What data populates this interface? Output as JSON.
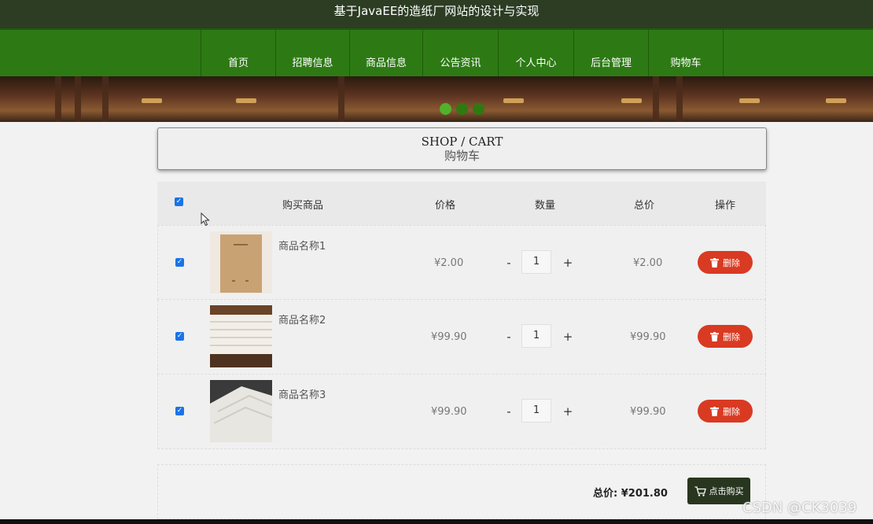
{
  "header": {
    "title": "基于JavaEE的造纸厂网站的设计与实现"
  },
  "nav": {
    "items": [
      "首页",
      "招聘信息",
      "商品信息",
      "公告资讯",
      "个人中心",
      "后台管理",
      "购物车"
    ]
  },
  "page_title": {
    "en": "SHOP / CART",
    "cn": "购物车"
  },
  "table": {
    "headers": {
      "product": "购买商品",
      "price": "价格",
      "quantity": "数量",
      "total": "总价",
      "action": "操作"
    },
    "rows": [
      {
        "name": "商品名称1",
        "price": "¥2.00",
        "qty": "1",
        "total": "¥2.00",
        "checked": true
      },
      {
        "name": "商品名称2",
        "price": "¥99.90",
        "qty": "1",
        "total": "¥99.90",
        "checked": true
      },
      {
        "name": "商品名称3",
        "price": "¥99.90",
        "qty": "1",
        "total": "¥99.90",
        "checked": true
      }
    ],
    "minus_label": "-",
    "plus_label": "+",
    "delete_label": "删除"
  },
  "footer": {
    "total_label": "总价: ",
    "total_value": "¥201.80",
    "buy_label": "点击购买"
  },
  "watermark": "CSDN @CK3039",
  "colors": {
    "nav": "#2d7a14",
    "topbar": "#2c3d24",
    "delete": "#d93a22",
    "buy": "#28361f"
  }
}
